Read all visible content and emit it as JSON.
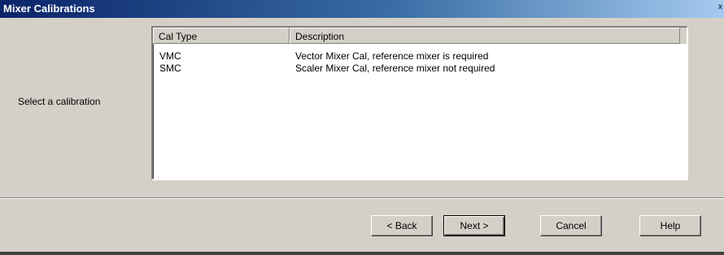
{
  "window": {
    "title": "Mixer Calibrations",
    "close_glyph": "x"
  },
  "prompt": "Select a calibration",
  "list": {
    "columns": [
      "Cal Type",
      "Description"
    ],
    "rows": [
      {
        "type": "VMC",
        "description": "Vector Mixer Cal, reference mixer is required"
      },
      {
        "type": "SMC",
        "description": "Scaler Mixer Cal, reference mixer not required"
      }
    ]
  },
  "buttons": {
    "back": "< Back",
    "next": "Next >",
    "cancel": "Cancel",
    "help": "Help"
  }
}
